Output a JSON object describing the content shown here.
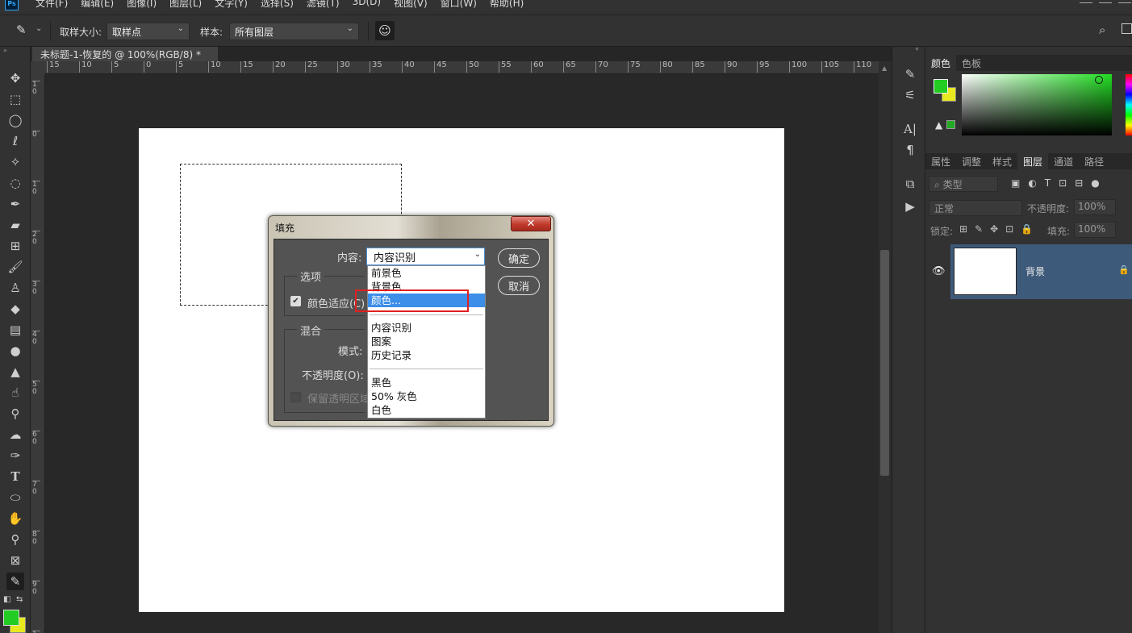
{
  "app": {
    "logo": "Ps"
  },
  "menu": [
    "文件(F)",
    "编辑(E)",
    "图像(I)",
    "图层(L)",
    "文字(Y)",
    "选择(S)",
    "滤镜(T)",
    "3D(D)",
    "视图(V)",
    "窗口(W)",
    "帮助(H)"
  ],
  "options": {
    "sample_size_label": "取样大小:",
    "sample_size_value": "取样点",
    "sample_label": "样本:",
    "sample_value": "所有图层"
  },
  "document": {
    "tab_title": "未标题-1-恢复的 @ 100%(RGB/8) *",
    "ruler_top": [
      "15",
      "10",
      "5",
      "0",
      "5",
      "10",
      "15",
      "20",
      "25",
      "30",
      "35",
      "40",
      "45",
      "50",
      "55",
      "60",
      "65",
      "70",
      "75",
      "80",
      "85",
      "90",
      "95",
      "100",
      "105",
      "110"
    ],
    "ruler_left": [
      "1\n0",
      "0",
      "1\n0",
      "2\n0",
      "3\n0",
      "4\n0",
      "5\n0",
      "6\n0",
      "7\n0",
      "8\n0",
      "9\n0",
      "1\n0"
    ]
  },
  "panels": {
    "color_tabs": [
      "颜色",
      "色板"
    ],
    "layer_tabs": [
      "属性",
      "调整",
      "样式",
      "图层",
      "通道",
      "路径"
    ],
    "filter_placeholder": "类型",
    "blend_mode": "正常",
    "opacity_label": "不透明度:",
    "opacity_value": "100%",
    "lock_label": "锁定:",
    "fill_label": "填充:",
    "fill_value": "100%",
    "layer_name": "背景",
    "foreground_color": "#22cc22",
    "background_color": "#e8e820"
  },
  "dialog": {
    "title": "填充",
    "close": "✕",
    "content_label": "内容:",
    "content_value": "内容识别",
    "ok": "确定",
    "cancel": "取消",
    "options_group": "选项",
    "color_adapt": "颜色适应(C)",
    "blend_group": "混合",
    "mode_label": "模式:",
    "opacity_label": "不透明度(O):",
    "preserve_label": "保留透明区域",
    "dropdown_items": [
      "前景色",
      "背景色",
      "颜色...",
      "内容识别",
      "图案",
      "历史记录",
      "黑色",
      "50% 灰色",
      "白色"
    ]
  }
}
